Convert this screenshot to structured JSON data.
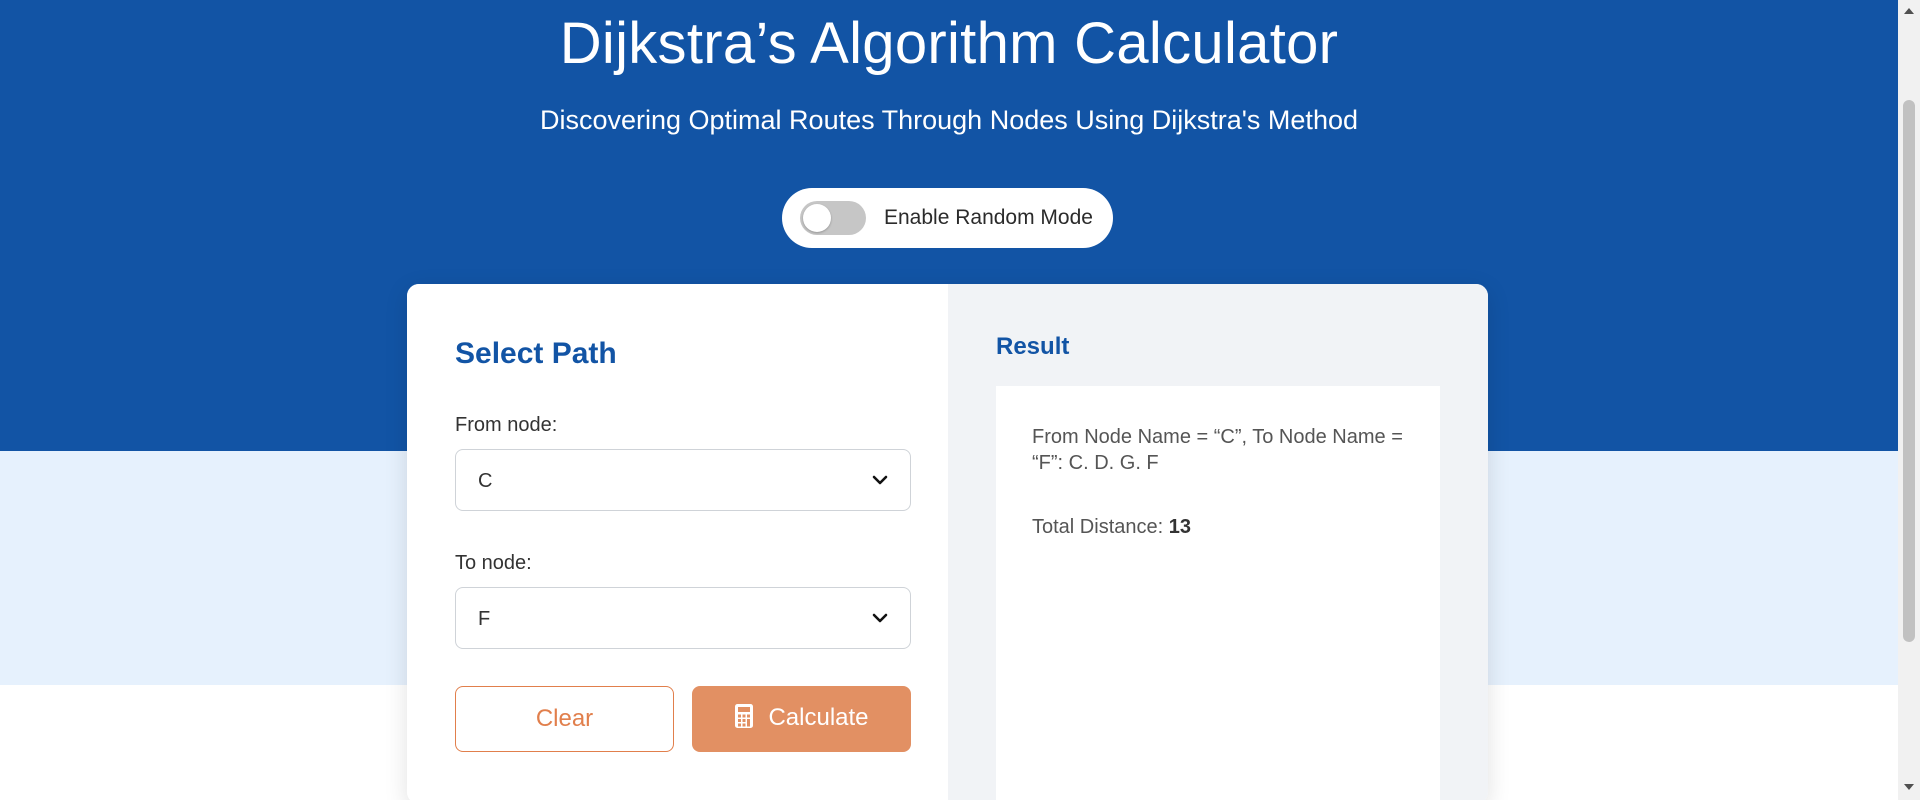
{
  "header": {
    "title": "Dijkstra’s Algorithm Calculator",
    "subtitle": "Discovering Optimal Routes Through Nodes Using Dijkstra's Method"
  },
  "random_mode": {
    "label": "Enable Random Mode",
    "enabled": false
  },
  "form": {
    "title": "Select Path",
    "from_label": "From node:",
    "from_value": "C",
    "to_label": "To node:",
    "to_value": "F",
    "clear_label": "Clear",
    "calculate_label": "Calculate",
    "calculate_icon": "calculator-icon"
  },
  "result": {
    "title": "Result",
    "path_text": "From Node Name = “C”, To Node Name = “F”: C. D. G. F",
    "distance_label": "Total Distance: ",
    "distance_value": "13"
  },
  "colors": {
    "header_bg": "#1254a5",
    "band_bg": "#e6f1fd",
    "accent_orange": "#e29063",
    "title_blue": "#1254a5"
  }
}
